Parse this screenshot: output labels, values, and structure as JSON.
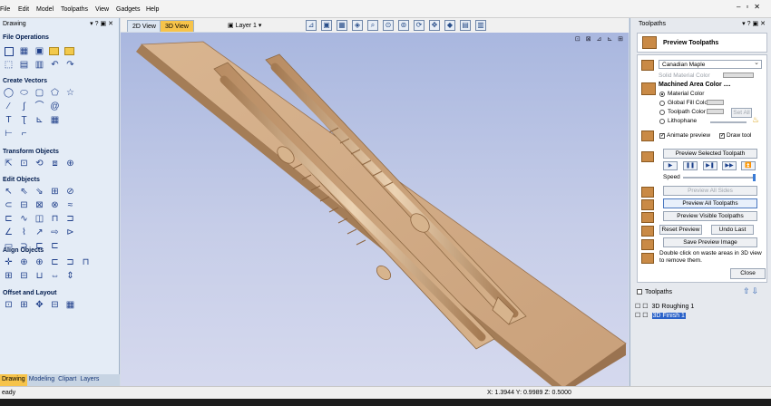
{
  "menu": [
    "File",
    "Edit",
    "Model",
    "Toolpaths",
    "View",
    "Gadgets",
    "Help"
  ],
  "left_panel": {
    "title": "Drawing",
    "sections": [
      {
        "title": "File Operations"
      },
      {
        "title": "Create Vectors"
      },
      {
        "title": "Transform Objects"
      },
      {
        "title": "Edit Objects"
      },
      {
        "title": "Align Objects"
      },
      {
        "title": "Offset and Layout"
      }
    ],
    "tabs": [
      "Drawing",
      "Modeling",
      "Clipart",
      "Layers"
    ]
  },
  "view_tabs": {
    "tab_2d": "2D View",
    "tab_3d": "3D View",
    "layer": "Layer 1"
  },
  "right_panel": {
    "title": "Toolpaths",
    "preview_title": "Preview Toolpaths",
    "material": "Canadian Maple",
    "solid_color": "Solid Material Color",
    "machined_title": "Machined Area Color ....",
    "opt_material": "Material Color",
    "opt_global": "Global Fill Color",
    "opt_toolpath": "Toolpath Color",
    "opt_litho": "Lithophane",
    "set_all": "Set All",
    "animate": "Animate preview",
    "draw_tool": "Draw tool",
    "preview_selected": "Preview Selected Toolpath",
    "speed": "Speed",
    "preview_all_sides": "Preview All Sides",
    "preview_all": "Preview All Toolpaths",
    "preview_visible": "Preview Visible Toolpaths",
    "reset_preview": "Reset Preview",
    "undo_last": "Undo Last",
    "save_image": "Save Preview Image",
    "hint": "Double click on waste areas in 3D view to remove them.",
    "close": "Close",
    "toolpaths_header": "Toolpaths",
    "toolpaths": [
      {
        "name": "3D Roughing 1",
        "selected": false
      },
      {
        "name": "3D Finish 1",
        "selected": true
      }
    ]
  },
  "status": {
    "left": "eady",
    "coords": "X: 1.3944 Y: 0.9989 Z: 0.5000"
  },
  "colors": {
    "wood": "#caa27a",
    "accent": "#f6c34a",
    "selection": "#2a62c9"
  }
}
